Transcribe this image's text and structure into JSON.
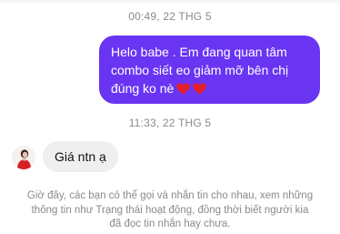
{
  "conversation": {
    "timestamp_1": "00:49, 22 THG 5",
    "outgoing_message": {
      "lines": [
        "Helo babe . Em đang quan tâm",
        "combo siết eo giảm mỡ bên chị",
        "đúng ko nè"
      ],
      "emoji": [
        "red-heart",
        "red-heart"
      ]
    },
    "timestamp_2": "11:33, 22 THG 5",
    "incoming_message": {
      "text": "Giá ntn ạ"
    },
    "notice": {
      "lines": [
        "Giờ đây, các bạn có thể gọi và nhắn tin cho nhau, xem những",
        "thông tin như Trạng thái hoạt động, đồng thời biết người kia",
        "đã đọc tin nhắn hay chưa."
      ]
    }
  },
  "colors": {
    "outgoing_bubble": "#6a34f3",
    "incoming_bubble": "#efefef",
    "meta_text": "#8a8a8e",
    "heart": "#e3202e"
  }
}
